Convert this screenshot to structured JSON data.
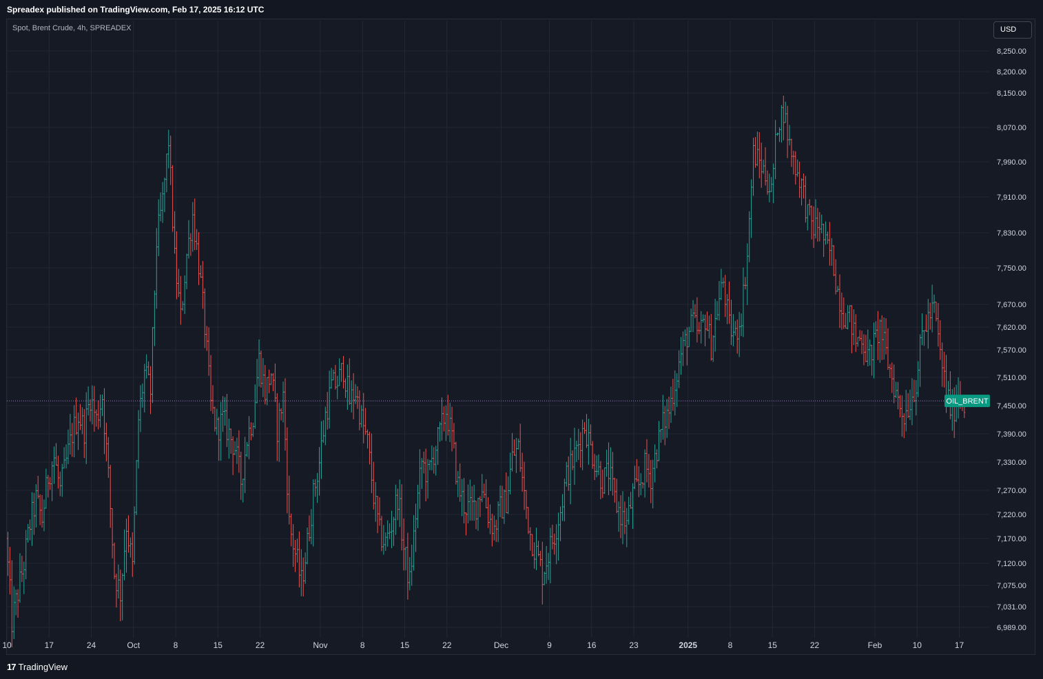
{
  "header": {
    "published_text": "Spreadex published on TradingView.com, Feb 17, 2025 16:12 UTC"
  },
  "chart_header": {
    "symbol_text": "Spot, Brent Crude, 4h, SPREADEX",
    "currency_button": "USD"
  },
  "footer": {
    "logo_mark": "17",
    "logo_text": "TradingView"
  },
  "colors": {
    "up": "#26a69a",
    "down": "#ef5350",
    "grid": "#232733",
    "background": "#161a25",
    "last_price_line": "#9c7bd1",
    "badge": "#089981"
  },
  "chart_data": {
    "type": "ohlc",
    "symbol": "Spot, Brent Crude, 4h, SPREADEX",
    "currency": "USD",
    "last_price_label": "OIL_BRENT",
    "last_price": 7460,
    "y_ticks": [
      {
        "label": "8,250.00",
        "value": 8250
      },
      {
        "label": "8,200.00",
        "value": 8200
      },
      {
        "label": "8,150.00",
        "value": 8150
      },
      {
        "label": "8,070.00",
        "value": 8070
      },
      {
        "label": "7,990.00",
        "value": 7990
      },
      {
        "label": "7,910.00",
        "value": 7910
      },
      {
        "label": "7,830.00",
        "value": 7830
      },
      {
        "label": "7,750.00",
        "value": 7750
      },
      {
        "label": "7,670.00",
        "value": 7670
      },
      {
        "label": "7,620.00",
        "value": 7620
      },
      {
        "label": "7,570.00",
        "value": 7570
      },
      {
        "label": "7,510.00",
        "value": 7510
      },
      {
        "label": "7,450.00",
        "value": 7450
      },
      {
        "label": "7,390.00",
        "value": 7390
      },
      {
        "label": "7,330.00",
        "value": 7330
      },
      {
        "label": "7,270.00",
        "value": 7270
      },
      {
        "label": "7,220.00",
        "value": 7220
      },
      {
        "label": "7,170.00",
        "value": 7170
      },
      {
        "label": "7,120.00",
        "value": 7120
      },
      {
        "label": "7,075.00",
        "value": 7075
      },
      {
        "label": "7,031.00",
        "value": 7031
      },
      {
        "label": "6,989.00",
        "value": 6989
      }
    ],
    "x_ticks": [
      {
        "label": "10",
        "day": 0
      },
      {
        "label": "17",
        "day": 7
      },
      {
        "label": "24",
        "day": 14
      },
      {
        "label": "Oct",
        "day": 21
      },
      {
        "label": "8",
        "day": 28
      },
      {
        "label": "15",
        "day": 35
      },
      {
        "label": "22",
        "day": 42
      },
      {
        "label": "Nov",
        "day": 52
      },
      {
        "label": "8",
        "day": 59
      },
      {
        "label": "15",
        "day": 66
      },
      {
        "label": "22",
        "day": 73
      },
      {
        "label": "Dec",
        "day": 82
      },
      {
        "label": "9",
        "day": 90
      },
      {
        "label": "16",
        "day": 97
      },
      {
        "label": "23",
        "day": 104
      },
      {
        "label": "2025",
        "day": 113
      },
      {
        "label": "8",
        "day": 120
      },
      {
        "label": "15",
        "day": 127
      },
      {
        "label": "22",
        "day": 134
      },
      {
        "label": "Feb",
        "day": 144
      },
      {
        "label": "10",
        "day": 151
      },
      {
        "label": "17",
        "day": 158
      }
    ],
    "x_range_days": [
      0,
      160
    ],
    "price_path": [
      [
        0,
        7170
      ],
      [
        1,
        7000
      ],
      [
        2,
        7060
      ],
      [
        3,
        7120
      ],
      [
        4,
        7200
      ],
      [
        5,
        7250
      ],
      [
        6,
        7210
      ],
      [
        7,
        7300
      ],
      [
        8,
        7340
      ],
      [
        9,
        7270
      ],
      [
        10,
        7330
      ],
      [
        11,
        7390
      ],
      [
        12,
        7430
      ],
      [
        13,
        7400
      ],
      [
        14,
        7470
      ],
      [
        15,
        7420
      ],
      [
        16,
        7470
      ],
      [
        17,
        7300
      ],
      [
        18,
        7100
      ],
      [
        19,
        7060
      ],
      [
        20,
        7200
      ],
      [
        21,
        7110
      ],
      [
        22,
        7420
      ],
      [
        23,
        7520
      ],
      [
        24,
        7480
      ],
      [
        25,
        7810
      ],
      [
        26,
        7900
      ],
      [
        27,
        8040
      ],
      [
        28,
        7770
      ],
      [
        29,
        7640
      ],
      [
        30,
        7780
      ],
      [
        31,
        7870
      ],
      [
        32,
        7760
      ],
      [
        33,
        7620
      ],
      [
        34,
        7450
      ],
      [
        35,
        7400
      ],
      [
        36,
        7420
      ],
      [
        37,
        7390
      ],
      [
        38,
        7360
      ],
      [
        39,
        7290
      ],
      [
        40,
        7380
      ],
      [
        41,
        7430
      ],
      [
        42,
        7550
      ],
      [
        43,
        7480
      ],
      [
        44,
        7520
      ],
      [
        45,
        7400
      ],
      [
        46,
        7470
      ],
      [
        47,
        7200
      ],
      [
        48,
        7140
      ],
      [
        49,
        7080
      ],
      [
        50,
        7160
      ],
      [
        51,
        7260
      ],
      [
        52,
        7330
      ],
      [
        53,
        7430
      ],
      [
        54,
        7490
      ],
      [
        55,
        7500
      ],
      [
        56,
        7530
      ],
      [
        57,
        7460
      ],
      [
        58,
        7480
      ],
      [
        59,
        7420
      ],
      [
        60,
        7370
      ],
      [
        61,
        7260
      ],
      [
        62,
        7180
      ],
      [
        63,
        7160
      ],
      [
        64,
        7200
      ],
      [
        65,
        7260
      ],
      [
        66,
        7150
      ],
      [
        67,
        7080
      ],
      [
        68,
        7220
      ],
      [
        69,
        7330
      ],
      [
        70,
        7300
      ],
      [
        71,
        7350
      ],
      [
        72,
        7390
      ],
      [
        73,
        7440
      ],
      [
        74,
        7380
      ],
      [
        75,
        7280
      ],
      [
        76,
        7240
      ],
      [
        77,
        7230
      ],
      [
        78,
        7240
      ],
      [
        79,
        7280
      ],
      [
        80,
        7220
      ],
      [
        81,
        7190
      ],
      [
        82,
        7230
      ],
      [
        83,
        7250
      ],
      [
        84,
        7340
      ],
      [
        85,
        7360
      ],
      [
        86,
        7260
      ],
      [
        87,
        7180
      ],
      [
        88,
        7140
      ],
      [
        89,
        7100
      ],
      [
        90,
        7140
      ],
      [
        91,
        7180
      ],
      [
        92,
        7230
      ],
      [
        93,
        7300
      ],
      [
        94,
        7330
      ],
      [
        95,
        7370
      ],
      [
        96,
        7410
      ],
      [
        97,
        7360
      ],
      [
        98,
        7320
      ],
      [
        99,
        7290
      ],
      [
        100,
        7310
      ],
      [
        101,
        7250
      ],
      [
        102,
        7220
      ],
      [
        103,
        7200
      ],
      [
        104,
        7260
      ],
      [
        105,
        7280
      ],
      [
        106,
        7320
      ],
      [
        107,
        7300
      ],
      [
        108,
        7360
      ],
      [
        109,
        7410
      ],
      [
        110,
        7440
      ],
      [
        111,
        7500
      ],
      [
        112,
        7560
      ],
      [
        113,
        7600
      ],
      [
        114,
        7630
      ],
      [
        115,
        7600
      ],
      [
        116,
        7640
      ],
      [
        117,
        7580
      ],
      [
        118,
        7660
      ],
      [
        119,
        7720
      ],
      [
        120,
        7620
      ],
      [
        121,
        7600
      ],
      [
        122,
        7650
      ],
      [
        123,
        7780
      ],
      [
        124,
        8010
      ],
      [
        125,
        7990
      ],
      [
        126,
        7960
      ],
      [
        127,
        7920
      ],
      [
        128,
        8080
      ],
      [
        129,
        8110
      ],
      [
        130,
        8030
      ],
      [
        131,
        7980
      ],
      [
        132,
        7940
      ],
      [
        133,
        7870
      ],
      [
        134,
        7840
      ],
      [
        135,
        7850
      ],
      [
        136,
        7800
      ],
      [
        137,
        7780
      ],
      [
        138,
        7700
      ],
      [
        139,
        7650
      ],
      [
        140,
        7640
      ],
      [
        141,
        7590
      ],
      [
        142,
        7600
      ],
      [
        143,
        7550
      ],
      [
        144,
        7580
      ],
      [
        145,
        7620
      ],
      [
        146,
        7560
      ],
      [
        147,
        7510
      ],
      [
        148,
        7460
      ],
      [
        149,
        7430
      ],
      [
        150,
        7460
      ],
      [
        151,
        7500
      ],
      [
        152,
        7600
      ],
      [
        153,
        7640
      ],
      [
        154,
        7660
      ],
      [
        155,
        7560
      ],
      [
        156,
        7480
      ],
      [
        157,
        7430
      ],
      [
        158,
        7480
      ],
      [
        159,
        7460
      ]
    ]
  }
}
